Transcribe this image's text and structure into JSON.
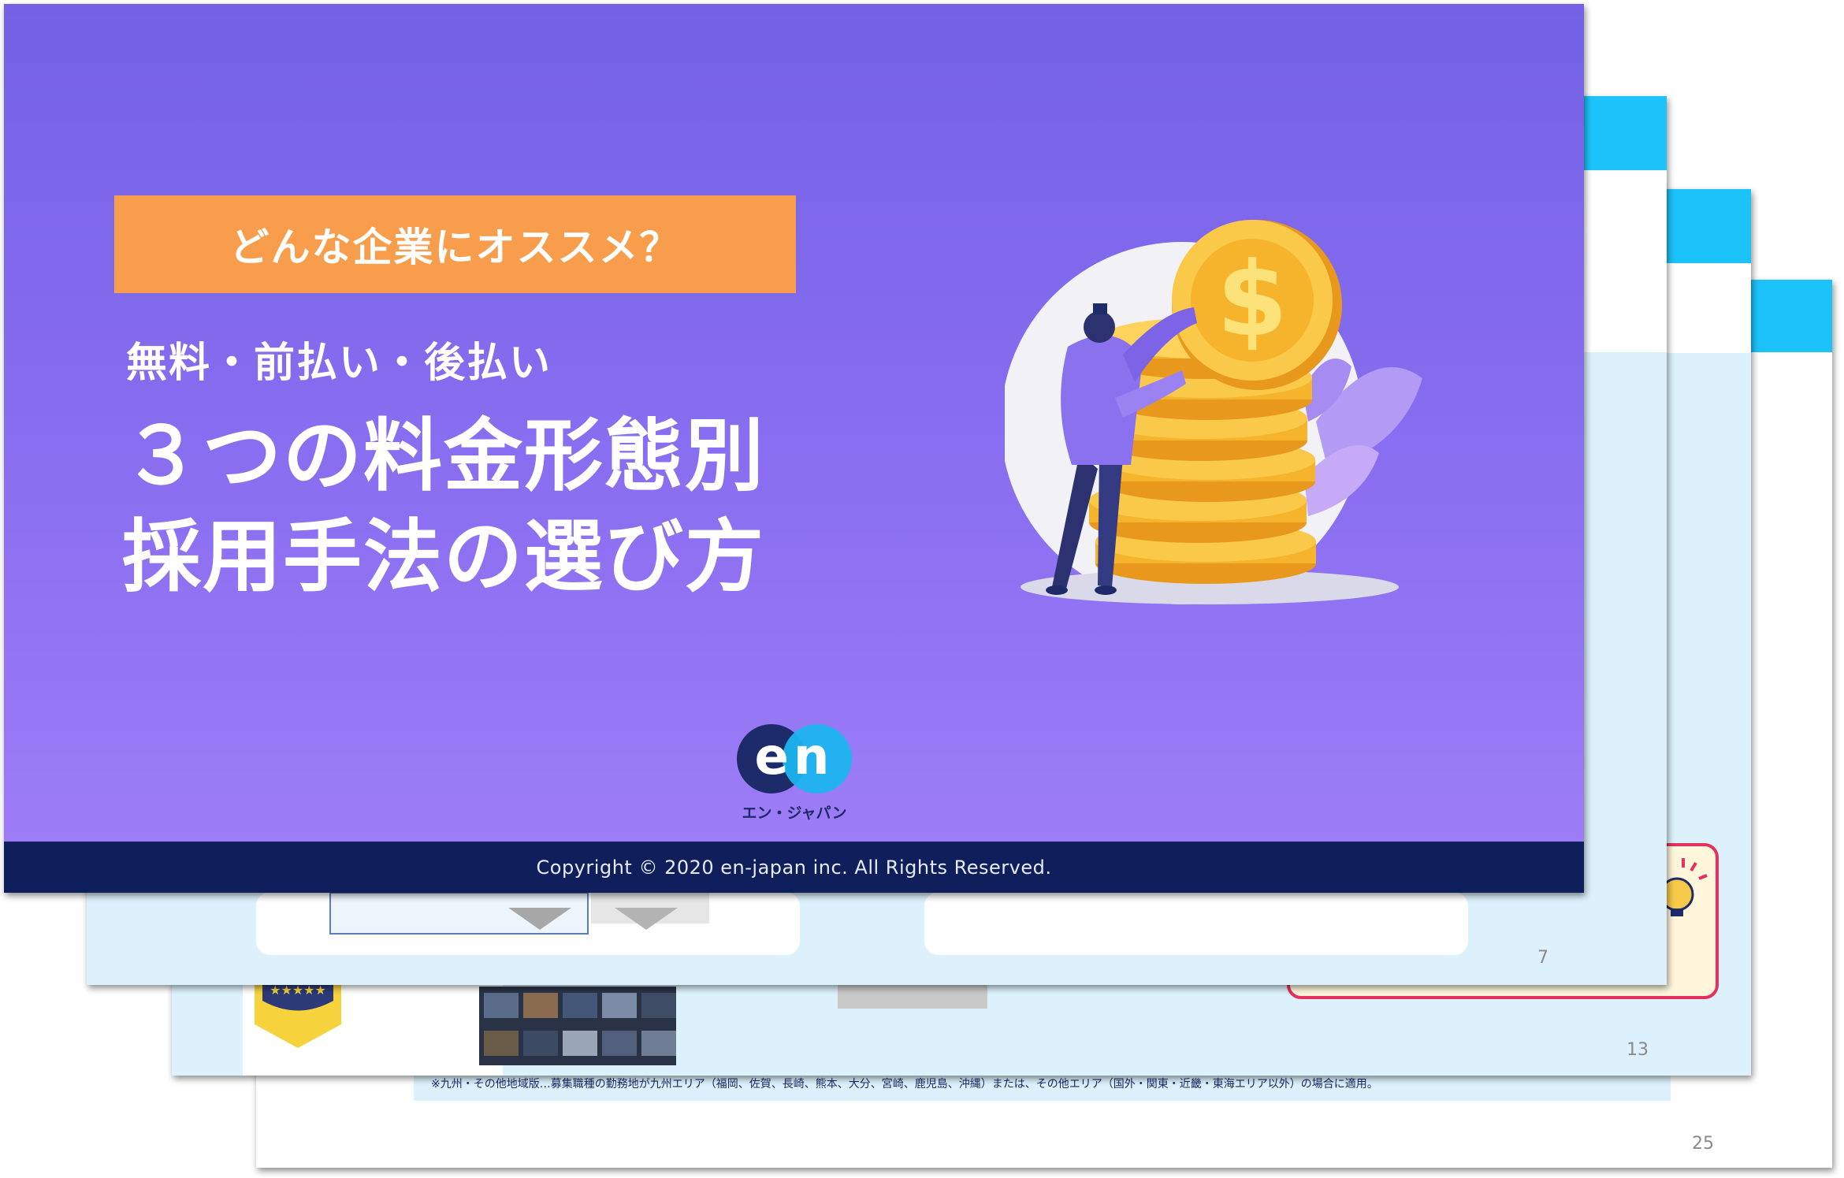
{
  "cover": {
    "tag": "どんな企業にオススメ？",
    "subtitle": "無料・前払い・後払い",
    "title_line1": "３つの料金形態別",
    "title_line2": "採用手法の選び方",
    "logo_text": "en",
    "logo_subtext": "エン・ジャパン",
    "copyright": "Copyright © 2020 en-japan inc. All Rights Reserved."
  },
  "stack": {
    "page_7": "7",
    "page_13": "13",
    "page_25": "25",
    "footnote_25": "※九州・その他地域版…募集職種の勤務地が九州エリア（福岡、佐賀、長崎、熊本、大分、宮崎、鹿児島、沖縄）または、その他エリア（国外・関東・近畿・東海エリア以外）の場合に適用。"
  },
  "colors": {
    "cover_purple": "#7461e5",
    "tag_orange": "#f89d4c",
    "footer_navy": "#0f1f5c",
    "header_cyan": "#1cc3fa",
    "panel_lightblue": "#dcf1fb",
    "coin_gold": "#f6b42c"
  }
}
